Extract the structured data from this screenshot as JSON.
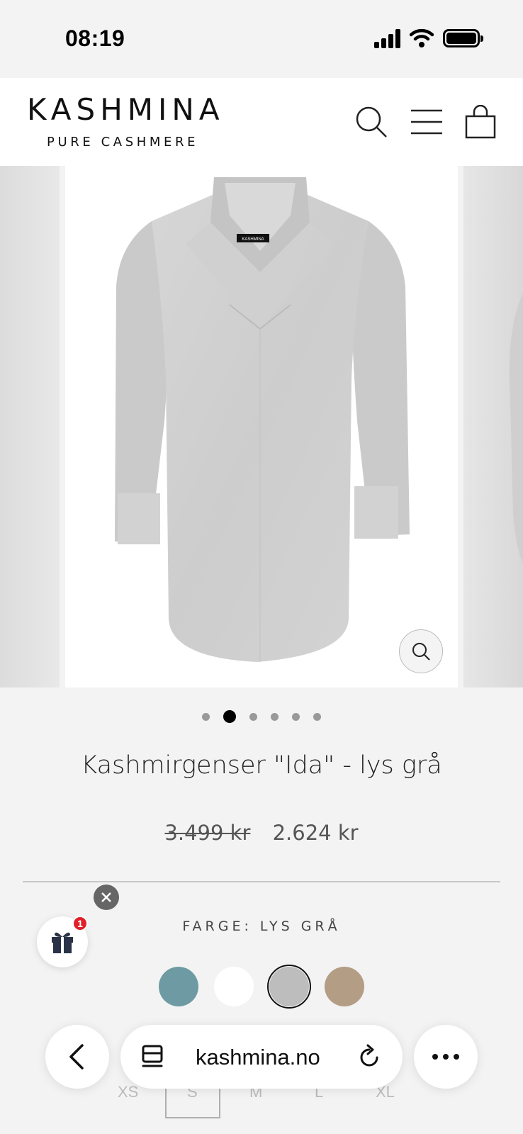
{
  "status_bar": {
    "time": "08:19"
  },
  "header": {
    "brand": "KASHMINA",
    "tagline": "PURE CASHMERE",
    "icons": [
      "search-icon",
      "menu-icon",
      "shopping-bag-icon"
    ]
  },
  "gallery": {
    "image_label": "KASHMINA",
    "slide_count": 6,
    "active_slide": 2
  },
  "product": {
    "title": "Kashmirgenser \"Ida\" - lys grå",
    "price_original": "3.499 kr",
    "price_sale": "2.624 kr"
  },
  "color_selector": {
    "label": "FARGE: LYS GRÅ",
    "swatches": [
      {
        "name": "teal",
        "color": "#6e9ba3"
      },
      {
        "name": "white",
        "color": "#ffffff"
      },
      {
        "name": "light-grey",
        "color": "#bdbdbd",
        "selected": true
      },
      {
        "name": "beige",
        "color": "#b49d85"
      }
    ]
  },
  "gift_widget": {
    "badge_count": "1"
  },
  "sizes": [
    "XS",
    "S",
    "M",
    "L",
    "XL"
  ],
  "browser": {
    "url": "kashmina.no"
  }
}
